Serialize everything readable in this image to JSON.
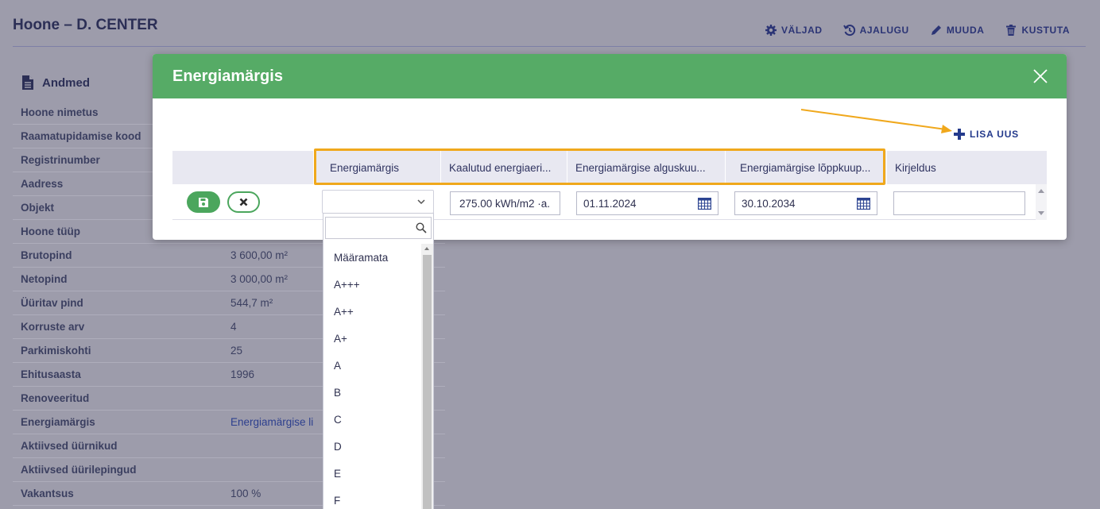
{
  "page": {
    "title": "Hoone – D. CENTER",
    "toolbar": [
      {
        "label": "VÄLJAD",
        "icon": "gear-icon"
      },
      {
        "label": "AJALUGU",
        "icon": "history-icon"
      },
      {
        "label": "MUUDA",
        "icon": "pencil-icon"
      },
      {
        "label": "KUSTUTA",
        "icon": "trash-icon"
      }
    ],
    "section_title": "Andmed",
    "rows": [
      {
        "label": "Hoone nimetus",
        "value": ""
      },
      {
        "label": "Raamatupidamise kood",
        "value": ""
      },
      {
        "label": "Registrinumber",
        "value": ""
      },
      {
        "label": "Aadress",
        "value": ""
      },
      {
        "label": "Objekt",
        "value": ""
      },
      {
        "label": "Hoone tüüp",
        "value": ""
      },
      {
        "label": "Brutopind",
        "value": "3 600,00 m²"
      },
      {
        "label": "Netopind",
        "value": "3 000,00 m²"
      },
      {
        "label": "Üüritav pind",
        "value": "544,7 m²"
      },
      {
        "label": "Korruste arv",
        "value": "4"
      },
      {
        "label": "Parkimiskohti",
        "value": "25"
      },
      {
        "label": "Ehitusaasta",
        "value": "1996"
      },
      {
        "label": "Renoveeritud",
        "value": ""
      },
      {
        "label": "Energiamärgis",
        "value": "Energiamärgise li"
      },
      {
        "label": "Aktiivsed üürnikud",
        "value": ""
      },
      {
        "label": "Aktiivsed üürilepingud",
        "value": ""
      },
      {
        "label": "Vakantsus",
        "value": "100 %"
      }
    ]
  },
  "modal": {
    "title": "Energiamärgis",
    "add_new_label": "LISA UUS",
    "columns": [
      "Energiamärgis",
      "Kaalutud energiaeri...",
      "Energiamärgise alguskuu...",
      "Energiamärgise lõppkuup...",
      "Kirjeldus"
    ],
    "row": {
      "energy_class": "",
      "weighted_energy": "275.00 kWh/m2 ·a.",
      "start_date": "01.11.2024",
      "end_date": "30.10.2034",
      "description": ""
    },
    "dropdown": {
      "search_value": "",
      "options": [
        "Määramata",
        "A+++",
        "A++",
        "A+",
        "A",
        "B",
        "C",
        "D",
        "E",
        "F"
      ]
    }
  },
  "colors": {
    "header_green": "#56ab66",
    "accent_blue": "#243a8c",
    "highlight_orange": "#f0a81c"
  }
}
